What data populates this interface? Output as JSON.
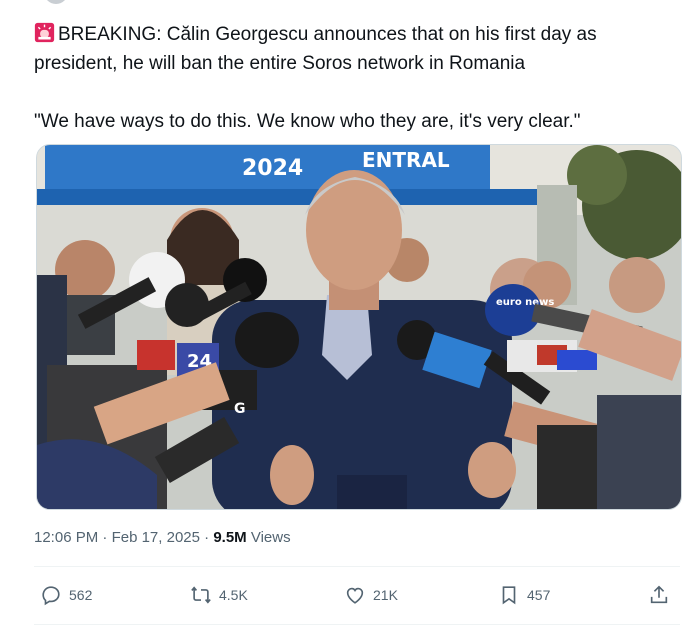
{
  "tweet": {
    "line1": "BREAKING: Călin Georgescu announces that on his first day as president, he will ban the entire Soros network in Romania",
    "quote": "\"We have ways to do this. We know who they are, it's very clear.\"",
    "emoji_icon": "rotating-light-icon"
  },
  "media": {
    "banner_text": "2024",
    "banner_text_2": "ENTRAL",
    "mic_label_1": "euro news",
    "mic_label_2": "24",
    "mic_label_3": "G"
  },
  "meta": {
    "time": "12:06 PM",
    "sep1": " · ",
    "date": "Feb 17, 2025",
    "sep2": " · ",
    "views_count": "9.5M",
    "views_label": " Views"
  },
  "actions": {
    "replies": "562",
    "reposts": "4.5K",
    "likes": "21K",
    "bookmarks": "457"
  },
  "colors": {
    "text": "#0f1419",
    "secondary": "#536471",
    "divider": "#eff3f4"
  }
}
